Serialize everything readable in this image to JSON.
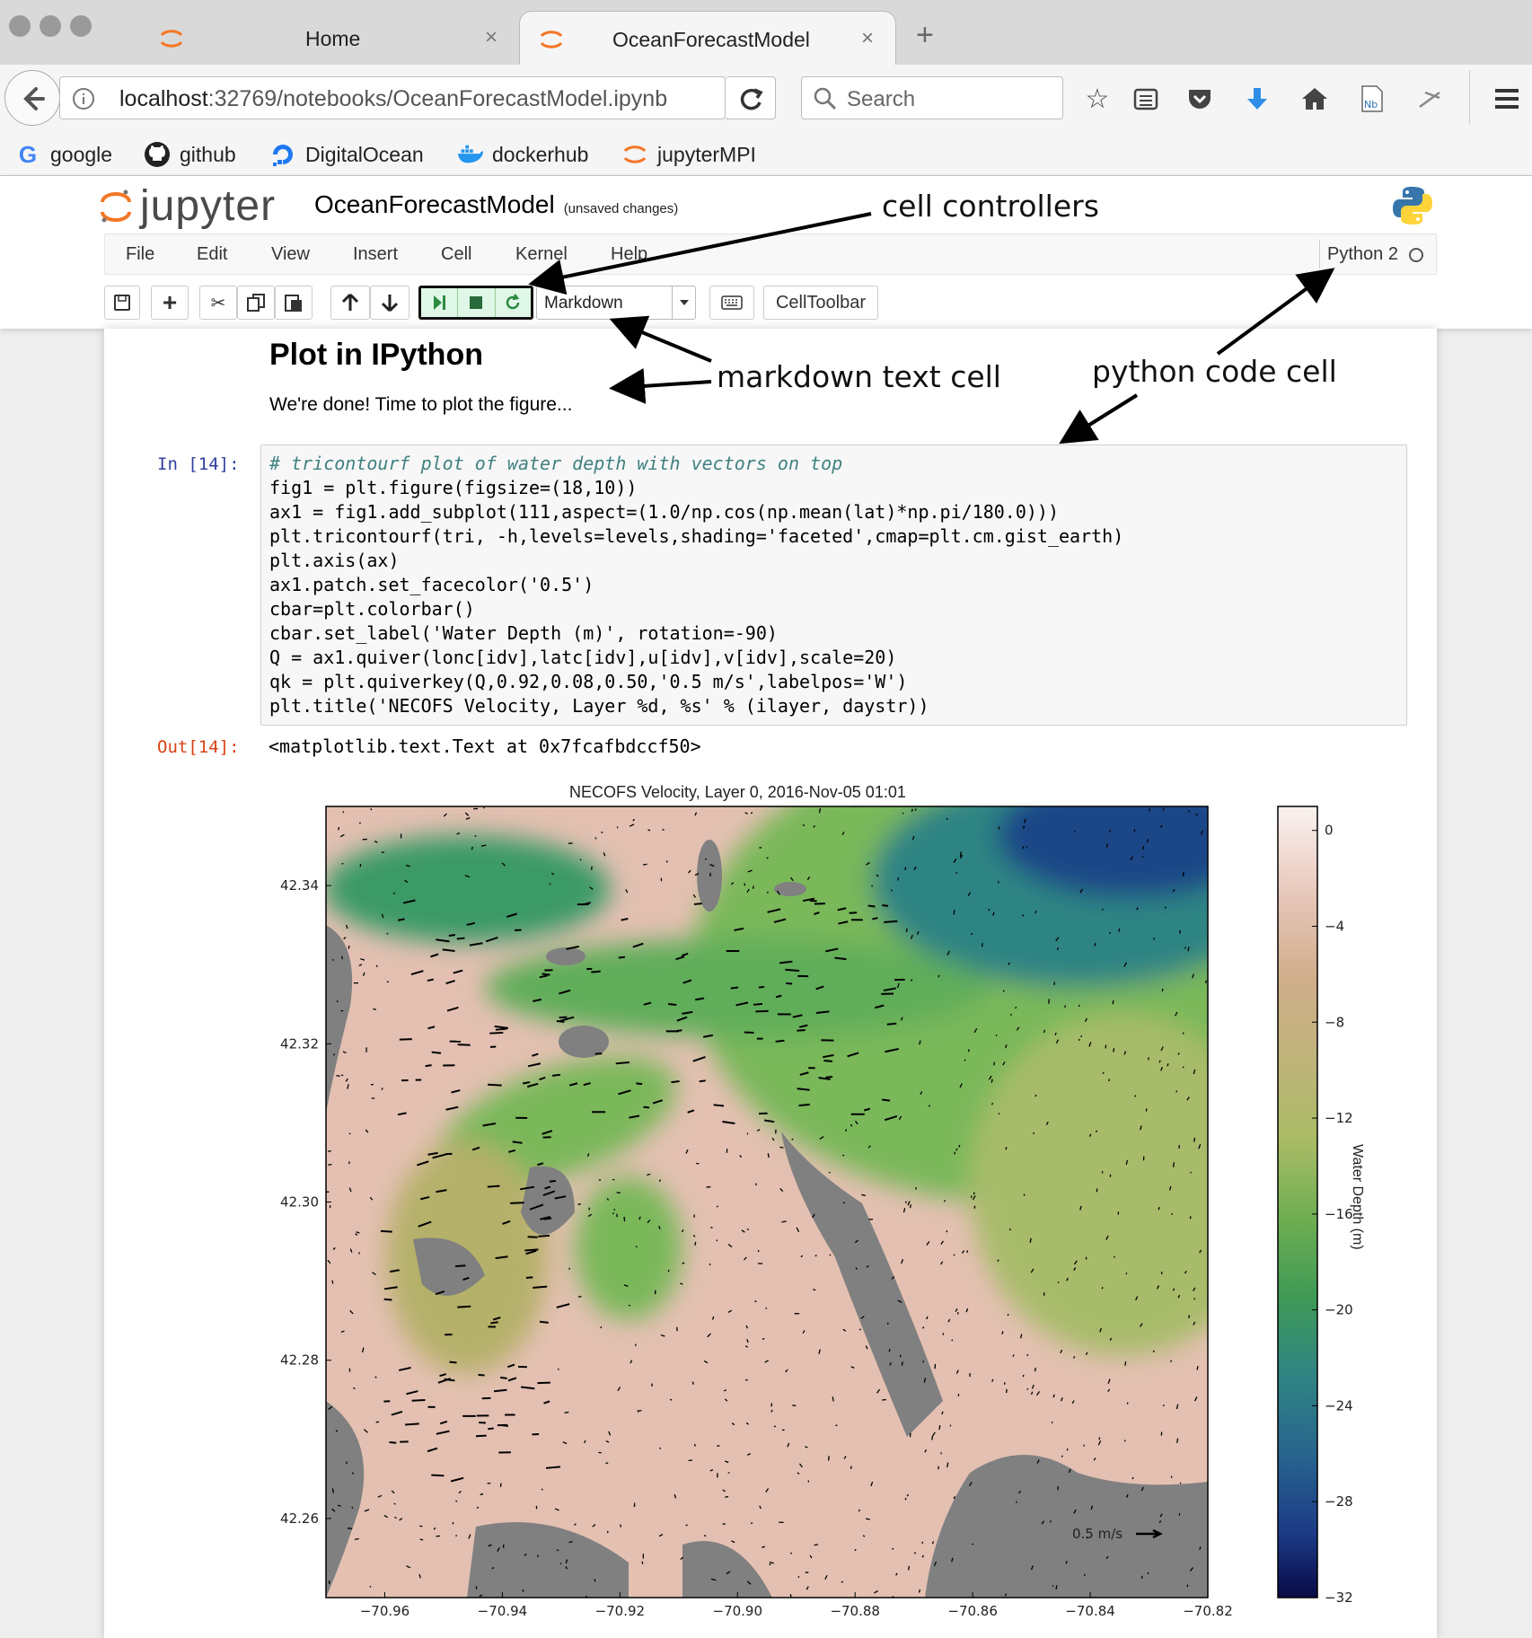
{
  "browser": {
    "tabs": [
      {
        "title": "Home",
        "active": false
      },
      {
        "title": "OceanForecastModel",
        "active": true
      }
    ],
    "tab_close_glyph": "×",
    "new_tab_glyph": "+",
    "url_host": "localhost",
    "url_rest": ":32769/notebooks/OceanForecastModel.ipynb",
    "search_placeholder": "Search",
    "bookmarks": [
      {
        "label": "google",
        "icon": "google-icon"
      },
      {
        "label": "github",
        "icon": "github-icon"
      },
      {
        "label": "DigitalOcean",
        "icon": "digitalocean-icon"
      },
      {
        "label": "dockerhub",
        "icon": "docker-icon"
      },
      {
        "label": "jupyterMPI",
        "icon": "jupyter-icon"
      }
    ]
  },
  "jupyter": {
    "brand": "jupyter",
    "notebook_name": "OceanForecastModel",
    "save_status": "(unsaved changes)",
    "menu": [
      "File",
      "Edit",
      "View",
      "Insert",
      "Cell",
      "Kernel",
      "Help"
    ],
    "kernel": "Python 2",
    "cell_type_select": "Markdown",
    "celltoolbar_label": "CellToolbar",
    "colors": {
      "brand_orange": "#f37726",
      "prompt_in": "#303f9f",
      "prompt_out": "#d84315"
    }
  },
  "notebook": {
    "markdown": {
      "heading": "Plot in IPython",
      "text": "We're done! Time to plot the figure..."
    },
    "code_cell": {
      "prompt": "In [14]:",
      "lines": [
        "# tricontourf plot of water depth with vectors on top",
        "fig1 = plt.figure(figsize=(18,10))",
        "ax1 = fig1.add_subplot(111,aspect=(1.0/np.cos(np.mean(lat)*np.pi/180.0)))",
        "plt.tricontourf(tri, -h,levels=levels,shading='faceted',cmap=plt.cm.gist_earth)",
        "plt.axis(ax)",
        "ax1.patch.set_facecolor('0.5')",
        "cbar=plt.colorbar()",
        "cbar.set_label('Water Depth (m)', rotation=-90)",
        "Q = ax1.quiver(lonc[idv],latc[idv],u[idv],v[idv],scale=20)",
        "qk = plt.quiverkey(Q,0.92,0.08,0.50,'0.5 m/s',labelpos='W')",
        "plt.title('NECOFS Velocity, Layer %d, %s' % (ilayer, daystr))"
      ]
    },
    "output": {
      "prompt": "Out[14]:",
      "text": "<matplotlib.text.Text at 0x7fcafbdccf50>"
    }
  },
  "chart_data": {
    "type": "heatmap",
    "title": "NECOFS Velocity, Layer 0, 2016-Nov-05 01:01",
    "x_ticks": [
      "−70.96",
      "−70.94",
      "−70.92",
      "−70.90",
      "−70.88",
      "−70.86",
      "−70.84",
      "−70.82"
    ],
    "y_ticks": [
      "42.34",
      "42.32",
      "42.30",
      "42.28",
      "42.26"
    ],
    "xlim": [
      -70.97,
      -70.82
    ],
    "ylim": [
      42.25,
      42.35
    ],
    "colorbar": {
      "label": "Water Depth (m)",
      "ticks": [
        "0",
        "−4",
        "−8",
        "−12",
        "−16",
        "−20",
        "−24",
        "−28",
        "−32"
      ],
      "range": [
        -32,
        1
      ],
      "colormap": "gist_earth"
    },
    "quiver_key": "0.5 m/s",
    "land_color": "#808080"
  },
  "annotations": {
    "cell_controllers": "cell controllers",
    "markdown_text_cell": "markdown text cell",
    "python_code_cell": "python code cell"
  }
}
